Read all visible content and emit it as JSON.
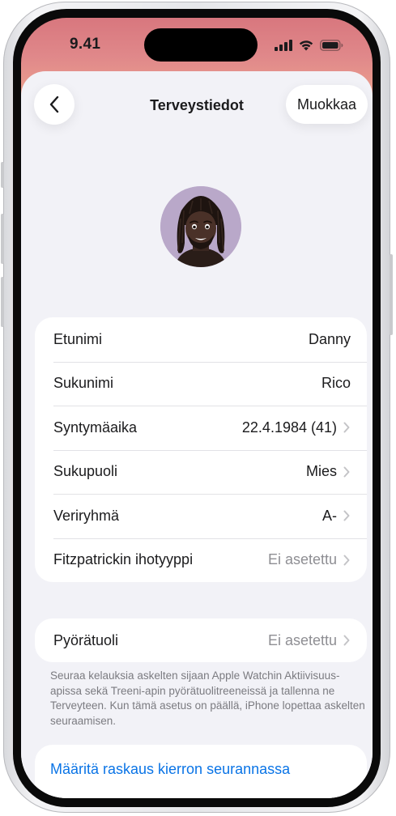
{
  "status_bar": {
    "time": "9.41"
  },
  "nav": {
    "title": "Terveystiedot",
    "edit_label": "Muokkaa",
    "back_icon": "chevron-left-icon"
  },
  "profile": {
    "avatar": "memoji-avatar",
    "avatar_bg": "#b9a8c9"
  },
  "details": [
    {
      "label": "Etunimi",
      "value": "Danny"
    },
    {
      "label": "Sukunimi",
      "value": "Rico"
    },
    {
      "label": "Syntymäaika",
      "value": "22.4.1984 (41)"
    },
    {
      "label": "Sukupuoli",
      "value": "Mies"
    },
    {
      "label": "Veriryhmä",
      "value": "A-"
    },
    {
      "label": "Fitzpatrickin ihotyyppi",
      "value": "Ei asetettu"
    }
  ],
  "wheelchair": {
    "label": "Pyörätuoli",
    "value": "Ei asetettu",
    "footnote": "Seuraa kelauksia askelten sijaan Apple Watchin Aktiivisuus-apissa sekä Treeni-apin pyörätuolitreeneissä ja tallenna ne Terveyteen. Kun tämä asetus on päällä, iPhone lopettaa askelten seuraamisen."
  },
  "pregnancy_link": {
    "label": "Määritä raskaus kierron seurannassa"
  },
  "colors": {
    "link": "#0a74e6",
    "muted": "#8e8e93",
    "background": "#f2f2f7",
    "header_gradient_top": "#d8777e",
    "header_gradient_bottom": "#eea58f"
  }
}
